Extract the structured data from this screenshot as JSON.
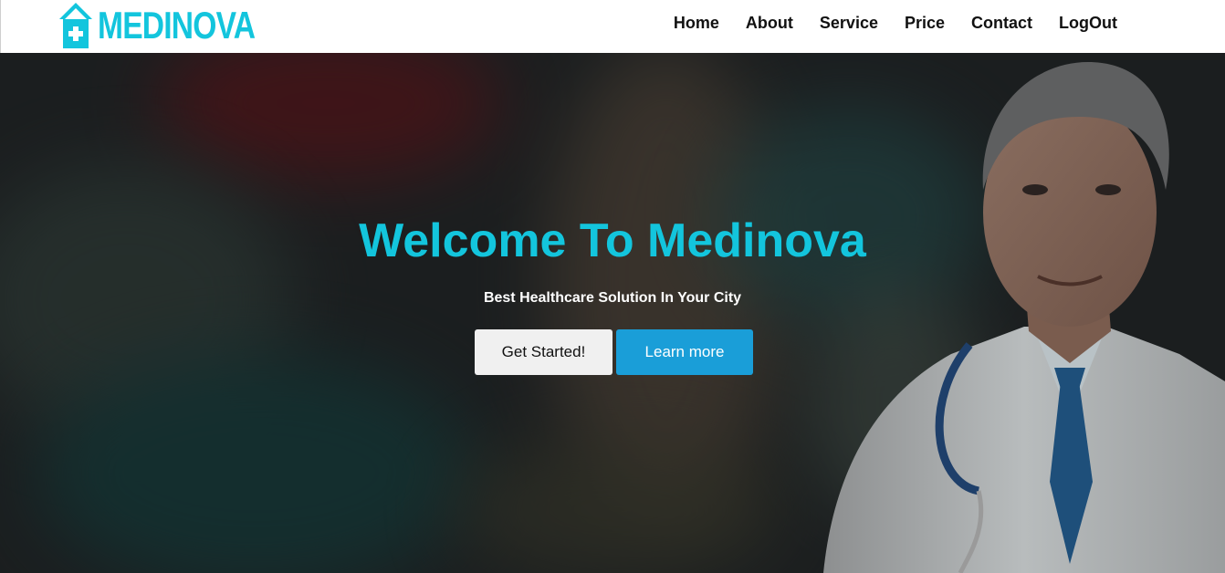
{
  "brand": {
    "name": "MEDINOVA",
    "icon": "hospital-house-icon",
    "color": "#13c5dd"
  },
  "nav": {
    "items": [
      {
        "label": "Home"
      },
      {
        "label": "About"
      },
      {
        "label": "Service"
      },
      {
        "label": "Price"
      },
      {
        "label": "Contact"
      },
      {
        "label": "LogOut"
      }
    ]
  },
  "hero": {
    "title": "Welcome To Medinova",
    "subtitle": "Best Healthcare Solution In Your City",
    "primary_button": "Get Started!",
    "secondary_button": "Learn more",
    "background": "blurred-hospital-photo",
    "foreground_image": "smiling-doctor-with-stethoscope"
  },
  "colors": {
    "accent": "#13c5dd",
    "button_blue": "#1a9ed8",
    "button_light": "#f0f0f0"
  }
}
